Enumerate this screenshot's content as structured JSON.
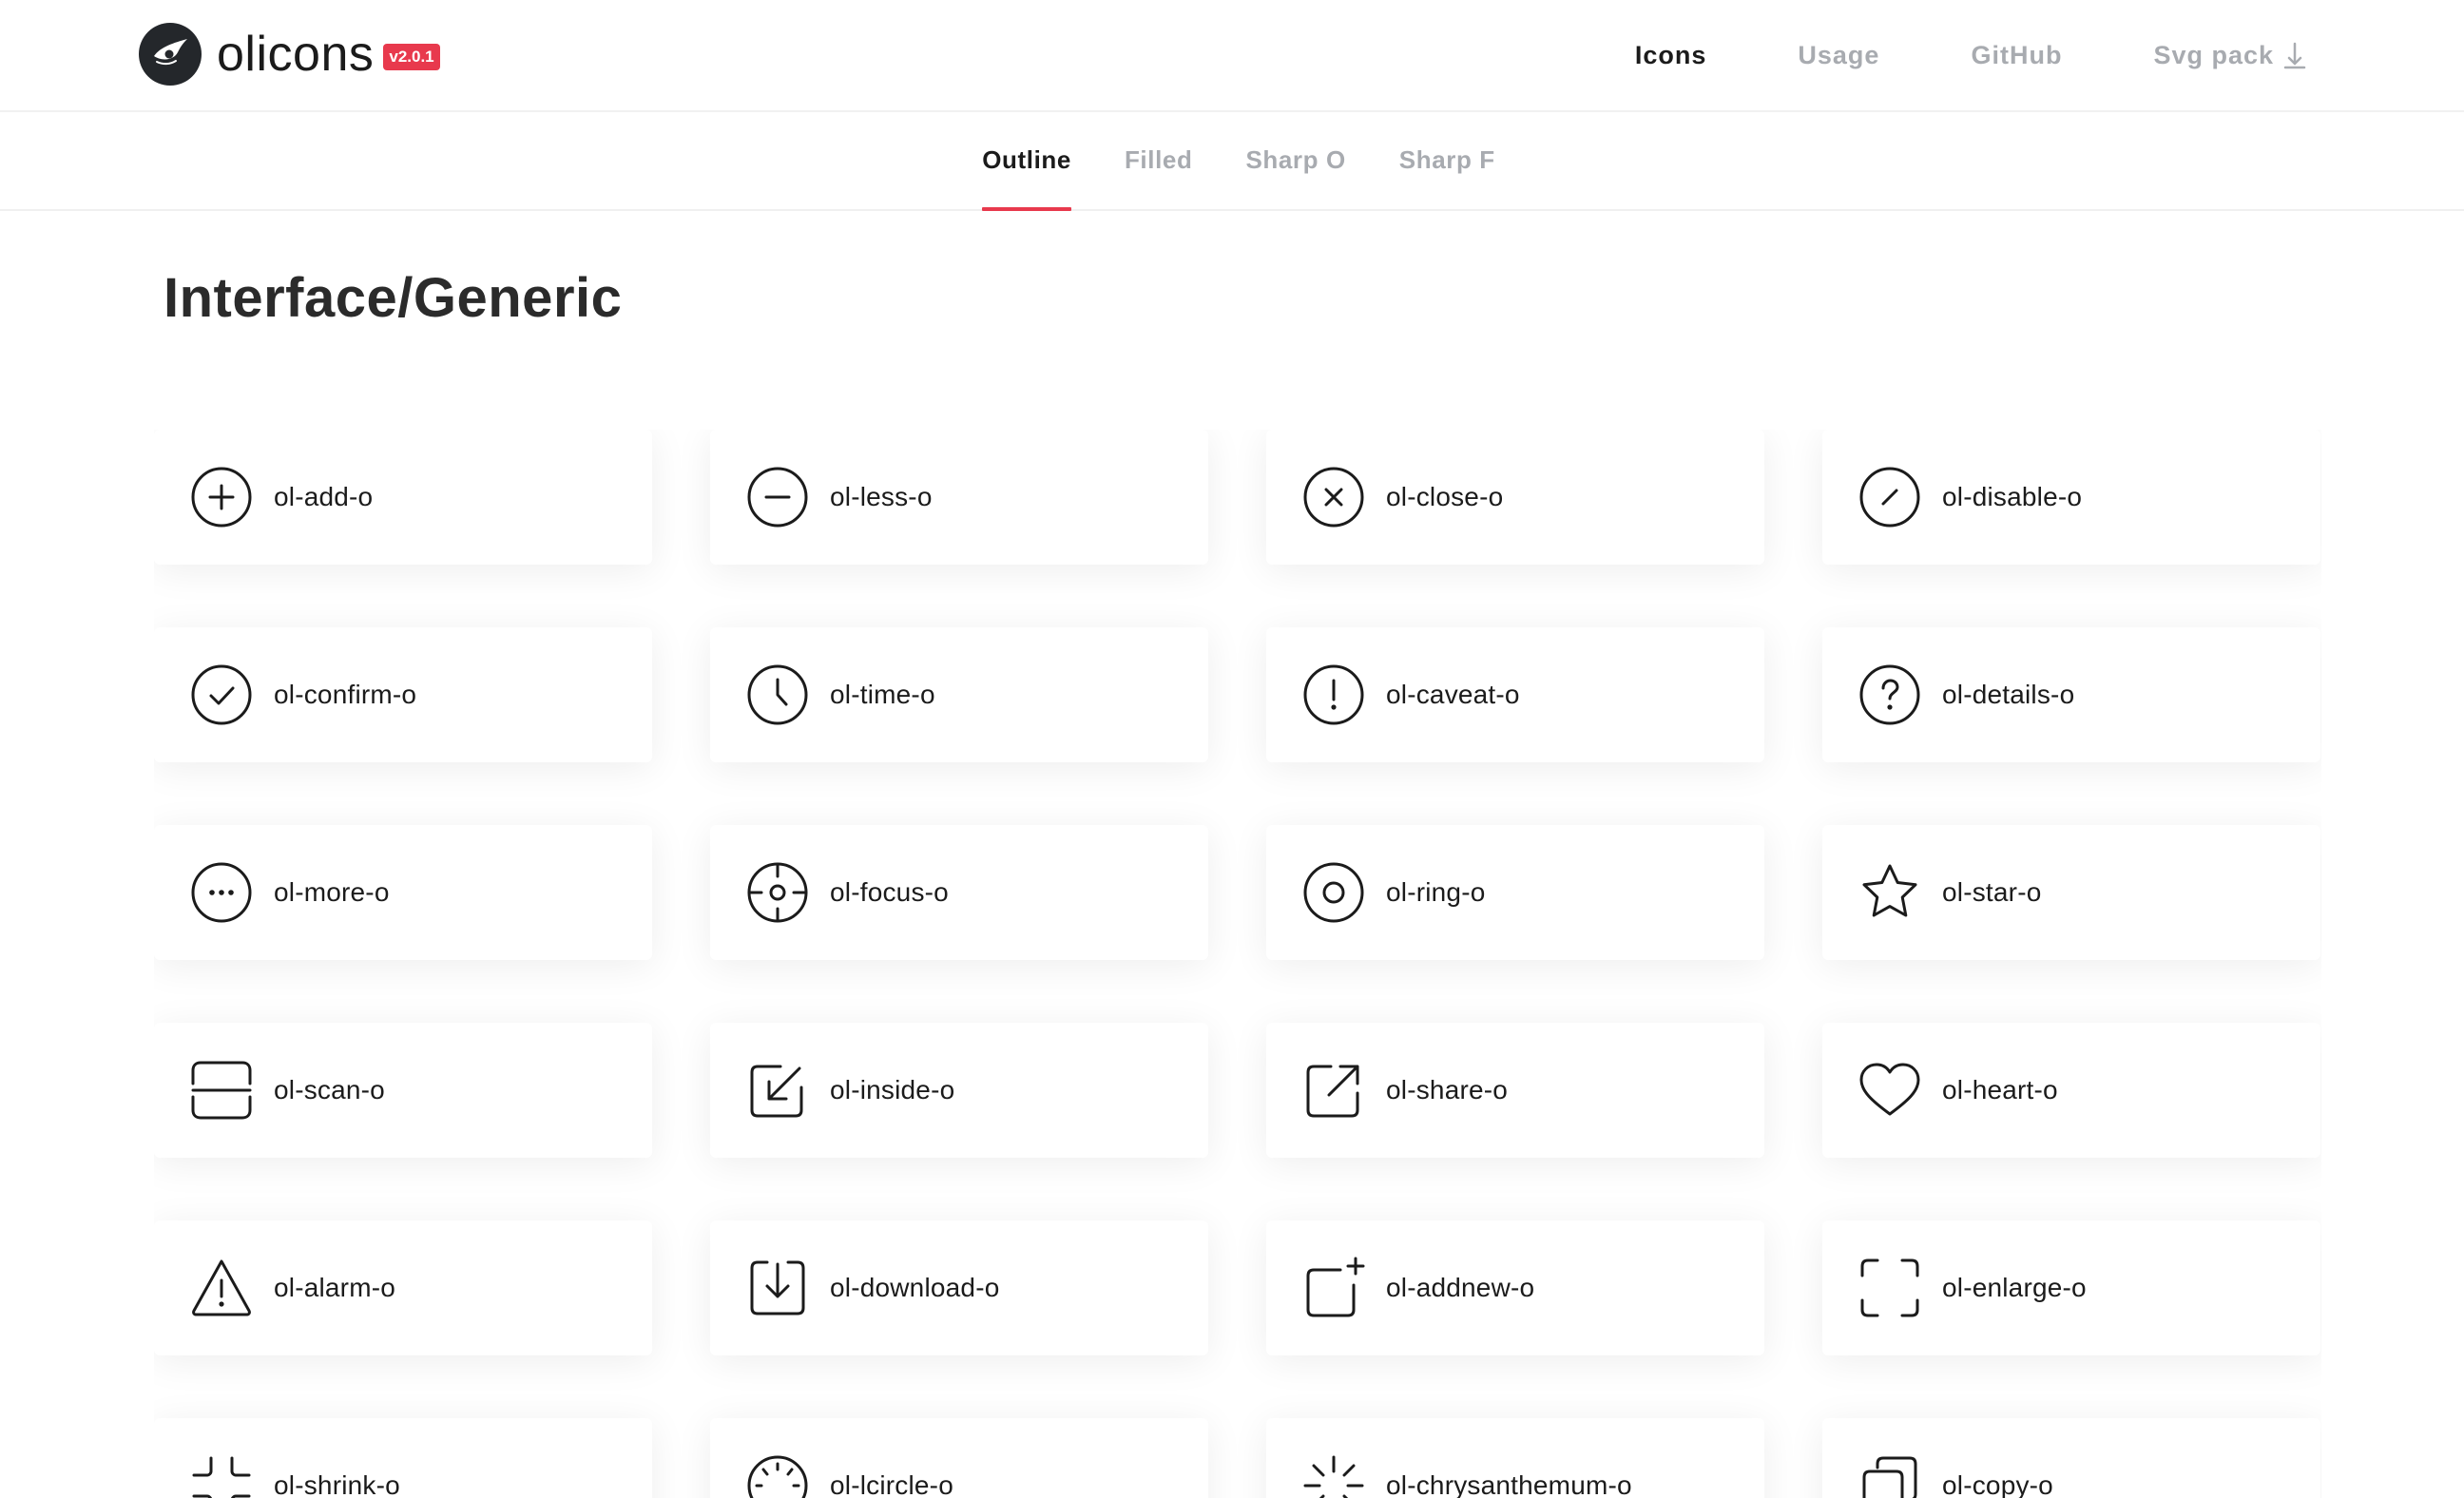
{
  "header": {
    "logo_text": "olicons",
    "version": "v2.0.1",
    "nav": [
      {
        "label": "Icons",
        "active": true
      },
      {
        "label": "Usage",
        "active": false
      },
      {
        "label": "GitHub",
        "active": false
      },
      {
        "label": "Svg pack",
        "active": false,
        "icon": "download-arrow-icon"
      }
    ]
  },
  "tabs": [
    {
      "label": "Outline",
      "active": true
    },
    {
      "label": "Filled",
      "active": false
    },
    {
      "label": "Sharp O",
      "active": false
    },
    {
      "label": "Sharp F",
      "active": false
    }
  ],
  "section": {
    "title": "Interface/Generic",
    "icons": [
      {
        "name": "ol-add-o",
        "icon": "add-icon"
      },
      {
        "name": "ol-less-o",
        "icon": "less-icon"
      },
      {
        "name": "ol-close-o",
        "icon": "close-icon"
      },
      {
        "name": "ol-disable-o",
        "icon": "disable-icon"
      },
      {
        "name": "ol-confirm-o",
        "icon": "confirm-icon"
      },
      {
        "name": "ol-time-o",
        "icon": "time-icon"
      },
      {
        "name": "ol-caveat-o",
        "icon": "caveat-icon"
      },
      {
        "name": "ol-details-o",
        "icon": "details-icon"
      },
      {
        "name": "ol-more-o",
        "icon": "more-icon"
      },
      {
        "name": "ol-focus-o",
        "icon": "focus-icon"
      },
      {
        "name": "ol-ring-o",
        "icon": "ring-icon"
      },
      {
        "name": "ol-star-o",
        "icon": "star-icon"
      },
      {
        "name": "ol-scan-o",
        "icon": "scan-icon"
      },
      {
        "name": "ol-inside-o",
        "icon": "inside-icon"
      },
      {
        "name": "ol-share-o",
        "icon": "share-icon"
      },
      {
        "name": "ol-heart-o",
        "icon": "heart-icon"
      },
      {
        "name": "ol-alarm-o",
        "icon": "alarm-icon"
      },
      {
        "name": "ol-download-o",
        "icon": "download-icon"
      },
      {
        "name": "ol-addnew-o",
        "icon": "addnew-icon"
      },
      {
        "name": "ol-enlarge-o",
        "icon": "enlarge-icon"
      },
      {
        "name": "ol-shrink-o",
        "icon": "shrink-icon"
      },
      {
        "name": "ol-lcircle-o",
        "icon": "lcircle-icon"
      },
      {
        "name": "ol-chrysanthemum-o",
        "icon": "chrysanthemum-icon"
      },
      {
        "name": "ol-copy-o",
        "icon": "copy-icon"
      }
    ]
  },
  "colors": {
    "accent": "#e8394d",
    "text": "#1b1b1b",
    "muted": "#a8abb0",
    "logo_bg": "#24272b"
  }
}
